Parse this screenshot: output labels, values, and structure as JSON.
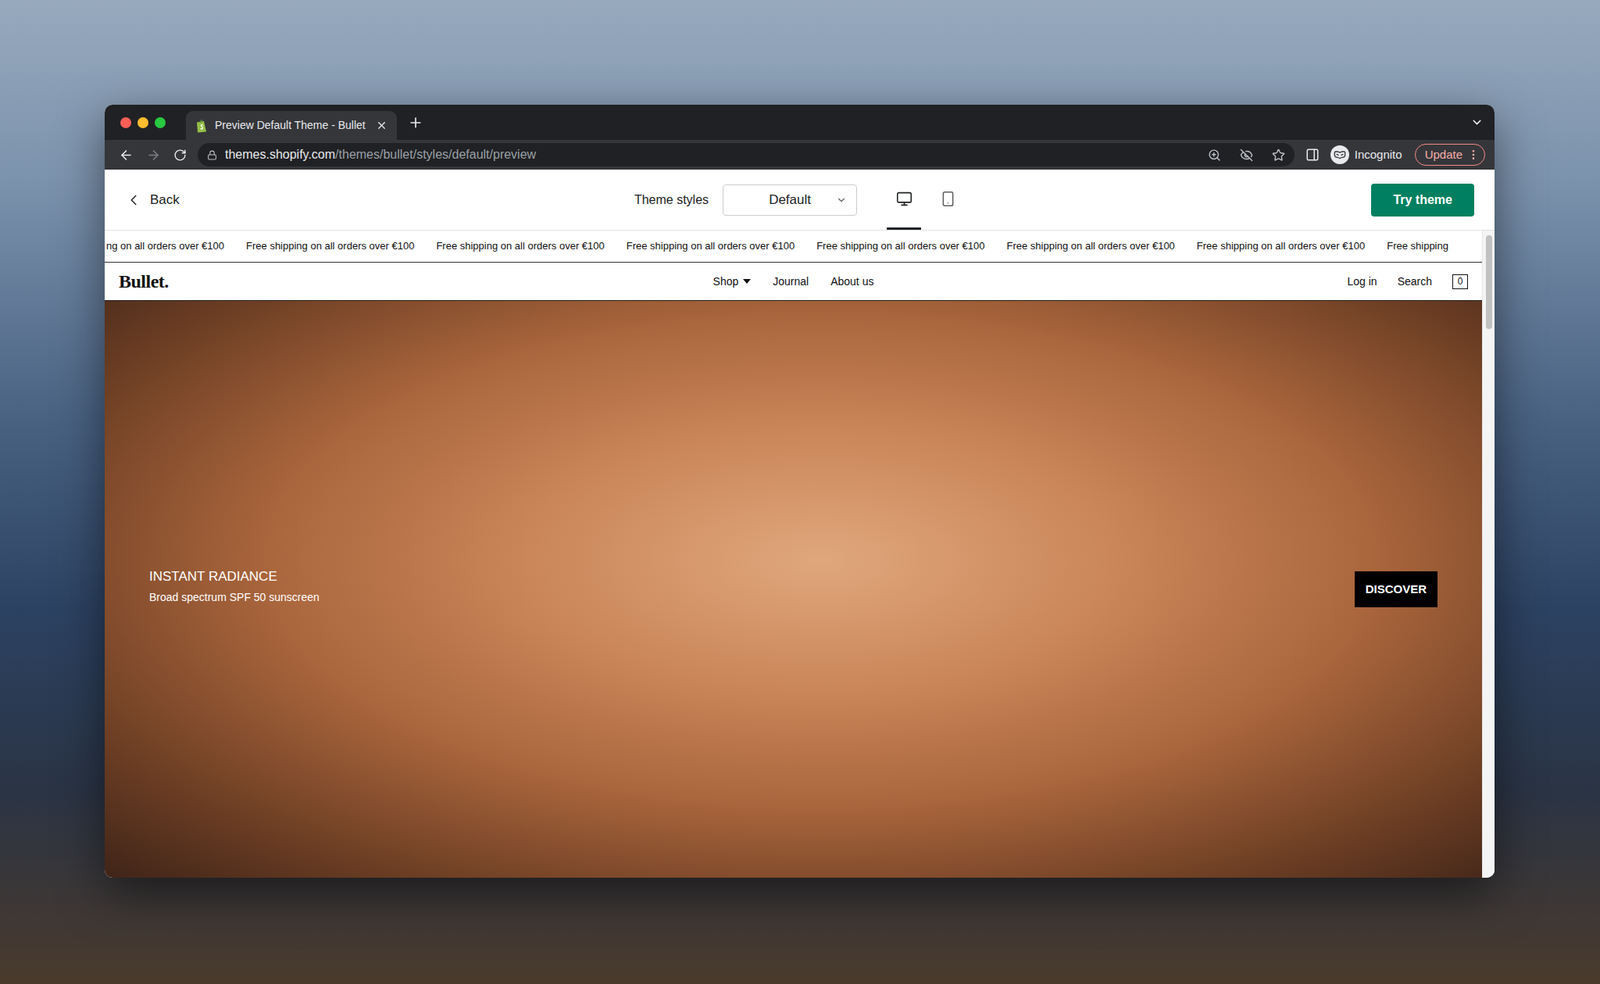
{
  "browser": {
    "tab_title": "Preview Default Theme - Bullet",
    "url_host": "themes.shopify.com",
    "url_path": "/themes/bullet/styles/default/preview",
    "profile": "Incognito",
    "update_button": "Update"
  },
  "preview_bar": {
    "back": "Back",
    "styles_label": "Theme styles",
    "style_value": "Default",
    "devices": [
      {
        "kind": "desktop",
        "selected": true
      },
      {
        "kind": "mobile",
        "selected": false
      }
    ],
    "try_button": "Try theme"
  },
  "announcement": [
    "ng on all orders over €100",
    "Free shipping on all orders over €100",
    "Free shipping on all orders over €100",
    "Free shipping on all orders over €100",
    "Free shipping on all orders over €100",
    "Free shipping on all orders over €100",
    "Free shipping on all orders over €100",
    "Free shipping"
  ],
  "store": {
    "logo": "Bullet.",
    "nav": [
      {
        "label": "Shop",
        "dropdown": true
      },
      {
        "label": "Journal",
        "dropdown": false
      },
      {
        "label": "About us",
        "dropdown": false
      }
    ],
    "actions": [
      "Log in",
      "Search"
    ],
    "cart_count": "0"
  },
  "hero": {
    "title": "INSTANT RADIANCE",
    "subtitle": "Broad spectrum SPF 50 sunscreen",
    "button": "DISCOVER"
  }
}
